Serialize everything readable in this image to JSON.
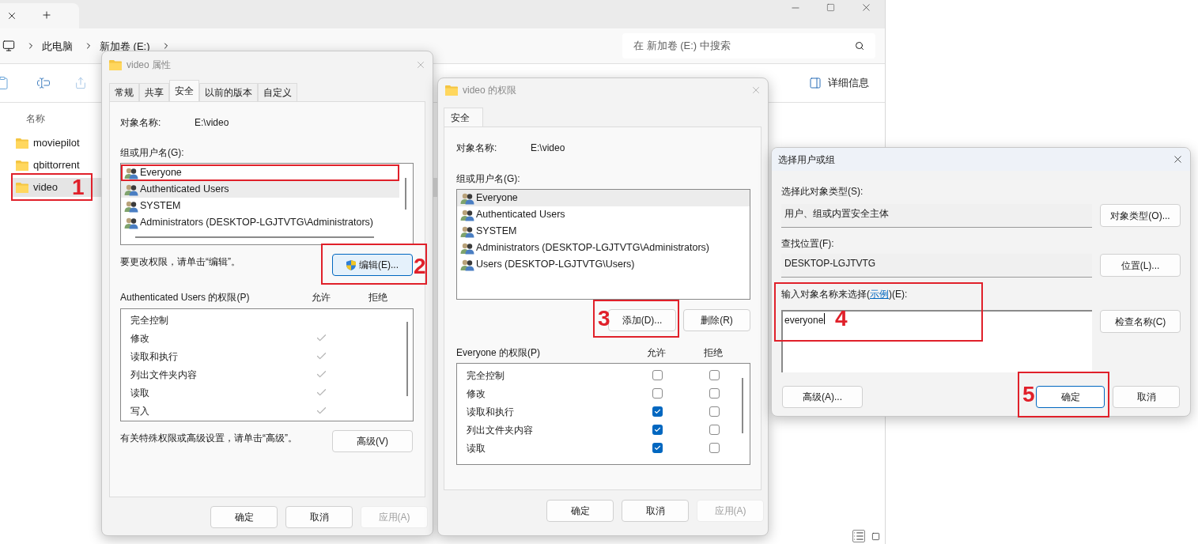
{
  "explorer": {
    "breadcrumb": [
      "此电脑",
      "新加卷 (E:)"
    ],
    "search": {
      "placeholder": "在 新加卷 (E:) 中搜索"
    },
    "details_button": "详细信息",
    "column_header": "名称",
    "files": [
      {
        "name": "moviepilot",
        "selected": false
      },
      {
        "name": "qbittorrent",
        "selected": false
      },
      {
        "name": "video",
        "selected": true
      }
    ]
  },
  "properties_dialog": {
    "title": "video 属性",
    "tabs": [
      {
        "label": "常规",
        "selected": false
      },
      {
        "label": "共享",
        "selected": false
      },
      {
        "label": "安全",
        "selected": true
      },
      {
        "label": "以前的版本",
        "selected": false
      },
      {
        "label": "自定义",
        "selected": false
      }
    ],
    "object_label": "对象名称:",
    "object_value": "E:\\video",
    "group_label": "组或用户名(G):",
    "principals": [
      {
        "name": "Everyone",
        "selected": false
      },
      {
        "name": "Authenticated Users",
        "selected": true
      },
      {
        "name": "SYSTEM",
        "selected": false
      },
      {
        "name": "Administrators (DESKTOP-LGJTVTG\\Administrators)",
        "selected": false
      }
    ],
    "edit_hint": "要更改权限，请单击“编辑”。",
    "edit_button": "编辑(E)...",
    "perm_label": "Authenticated Users 的权限(P)",
    "allow_label": "允许",
    "deny_label": "拒绝",
    "permissions": [
      {
        "name": "完全控制",
        "allow": false,
        "deny": false
      },
      {
        "name": "修改",
        "allow": true,
        "deny": false
      },
      {
        "name": "读取和执行",
        "allow": true,
        "deny": false
      },
      {
        "name": "列出文件夹内容",
        "allow": true,
        "deny": false
      },
      {
        "name": "读取",
        "allow": true,
        "deny": false
      },
      {
        "name": "写入",
        "allow": true,
        "deny": false
      }
    ],
    "advanced_hint": "有关特殊权限或高级设置，请单击“高级”。",
    "advanced_button": "高级(V)",
    "buttons": [
      {
        "label": "确定",
        "disabled": false
      },
      {
        "label": "取消",
        "disabled": false
      },
      {
        "label": "应用(A)",
        "disabled": true
      }
    ]
  },
  "permissions_dialog": {
    "title": "video 的权限",
    "tabs": [
      {
        "label": "安全",
        "selected": true
      }
    ],
    "object_label": "对象名称:",
    "object_value": "E:\\video",
    "group_label": "组或用户名(G):",
    "principals": [
      {
        "name": "Everyone",
        "selected": true
      },
      {
        "name": "Authenticated Users",
        "selected": false
      },
      {
        "name": "SYSTEM",
        "selected": false
      },
      {
        "name": "Administrators (DESKTOP-LGJTVTG\\Administrators)",
        "selected": false
      },
      {
        "name": "Users (DESKTOP-LGJTVTG\\Users)",
        "selected": false
      }
    ],
    "add_button": "添加(D)...",
    "remove_button": "删除(R)",
    "perm_label": "Everyone 的权限(P)",
    "allow_label": "允许",
    "deny_label": "拒绝",
    "permissions": [
      {
        "name": "完全控制",
        "allow": false,
        "deny": false
      },
      {
        "name": "修改",
        "allow": false,
        "deny": false
      },
      {
        "name": "读取和执行",
        "allow": true,
        "deny": false
      },
      {
        "name": "列出文件夹内容",
        "allow": true,
        "deny": false
      },
      {
        "name": "读取",
        "allow": true,
        "deny": false
      }
    ],
    "buttons": [
      {
        "label": "确定",
        "disabled": false
      },
      {
        "label": "取消",
        "disabled": false
      },
      {
        "label": "应用(A)",
        "disabled": true
      }
    ]
  },
  "select_dialog": {
    "title": "选择用户或组",
    "type_label": "选择此对象类型(S):",
    "type_value": "用户、组或内置安全主体",
    "type_button": "对象类型(O)...",
    "location_label": "查找位置(F):",
    "location_value": "DESKTOP-LGJTVTG",
    "location_button": "位置(L)...",
    "names_label": "输入对象名称来选择(",
    "names_link": "示例",
    "names_label_end": ")(E):",
    "names_value": "everyone",
    "check_button": "检查名称(C)",
    "advanced_button": "高级(A)...",
    "ok_button": "确定",
    "cancel_button": "取消"
  },
  "annotations": [
    "1",
    "2",
    "3",
    "4",
    "5"
  ]
}
